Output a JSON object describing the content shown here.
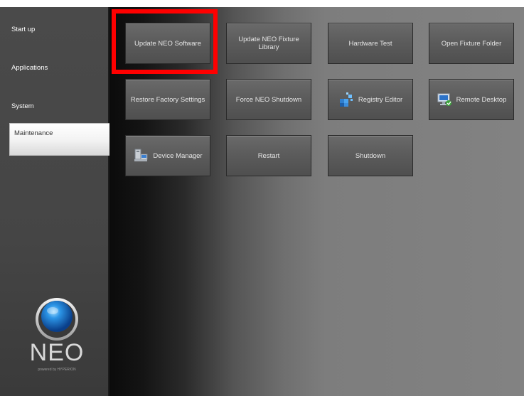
{
  "sidebar": {
    "items": [
      {
        "label": "Start up"
      },
      {
        "label": "Applications"
      },
      {
        "label": "System"
      },
      {
        "label": "Maintenance"
      }
    ],
    "logo": {
      "text": "NEO",
      "subtext": "powered by HYPERION"
    }
  },
  "main": {
    "buttons": [
      {
        "label": "Update NEO Software"
      },
      {
        "label": "Update NEO Fixture Library"
      },
      {
        "label": "Hardware Test"
      },
      {
        "label": "Open Fixture Folder"
      },
      {
        "label": "Restore Factory Settings"
      },
      {
        "label": "Force NEO Shutdown"
      },
      {
        "label": "Registry Editor",
        "icon": "registry-editor-icon"
      },
      {
        "label": "Remote Desktop",
        "icon": "remote-desktop-icon"
      },
      {
        "label": "Device Manager",
        "icon": "device-manager-icon"
      },
      {
        "label": "Restart"
      },
      {
        "label": "Shutdown"
      }
    ]
  },
  "colors": {
    "highlight": "#ff0000",
    "sidebar": "#474747"
  }
}
